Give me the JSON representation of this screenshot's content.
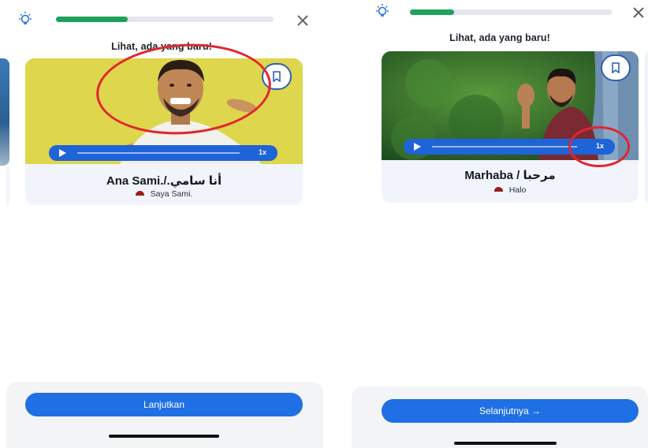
{
  "left": {
    "progress": 0.33,
    "prompt": "Lihat, ada yang baru!",
    "phrase": "Ana Sami./.أنا سامي",
    "translation": "Saya Sami.",
    "speed": "1x",
    "cta": "Lanjutkan",
    "icons": {
      "hint": "lightbulb-icon",
      "close": "close-icon",
      "bookmark": "bookmark-icon",
      "play": "play-icon",
      "flag": "indonesia-flag-icon"
    }
  },
  "right": {
    "progress": 0.22,
    "prompt": "Lihat, ada yang baru!",
    "phrase": "Marhaba / مرحبا",
    "translation": "Halo",
    "speed": "1x",
    "cta": "Selanjutnya →",
    "icons": {
      "hint": "lightbulb-icon",
      "close": "close-icon",
      "bookmark": "bookmark-icon",
      "play": "play-icon",
      "flag": "indonesia-flag-icon"
    }
  },
  "colors": {
    "accent": "#1f6fe5",
    "progress": "#1ea25a",
    "annotation": "#e1252d",
    "flag": "#9b1c1c"
  }
}
